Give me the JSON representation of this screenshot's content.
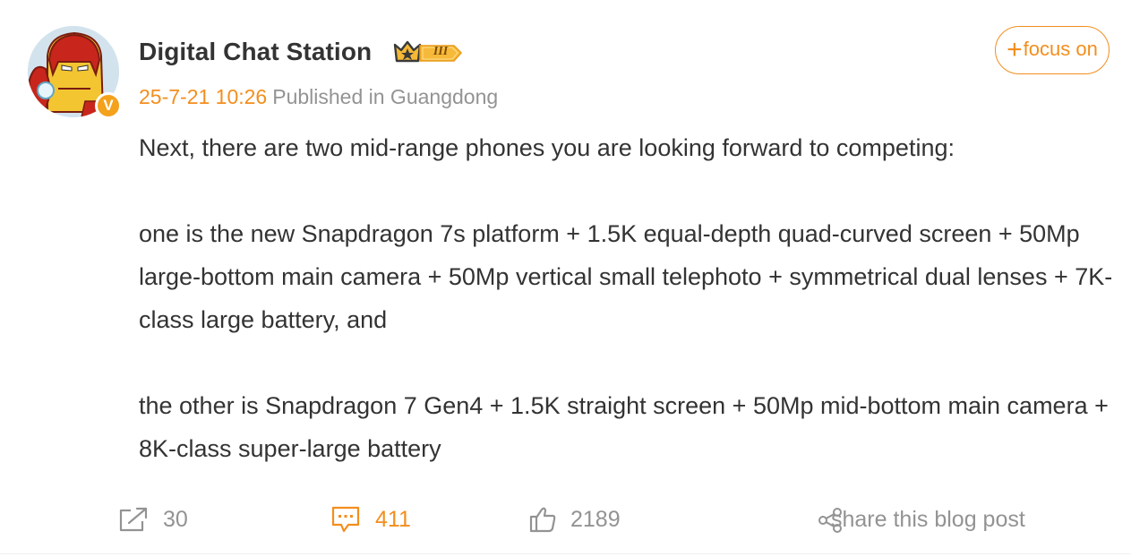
{
  "author": {
    "name": "Digital Chat Station",
    "level_badge": "III",
    "verified_badge": "V",
    "verified_color": "#f4a11c"
  },
  "meta": {
    "time": "25-7-21 10:26",
    "location": "Published in Guangdong"
  },
  "follow": {
    "plus": "+",
    "label": "focus on"
  },
  "post": {
    "paragraphs": [
      "Next, there are two mid-range phones you are looking forward to competing:",
      "one is the new Snapdragon 7s platform + 1.5K equal-depth quad-curved screen + 50Mp large-bottom main camera + 50Mp vertical small telephoto + symmetrical dual lenses + 7K-class large battery, and",
      "the other is Snapdragon 7 Gen4 + 1.5K straight screen + 50Mp mid-bottom main camera + 8K-class super-large battery"
    ]
  },
  "actions": {
    "repost": {
      "icon": "repost-icon",
      "count": "30"
    },
    "comments": {
      "icon": "comment-icon",
      "count": "411"
    },
    "likes": {
      "icon": "thumbs-up-icon",
      "count": "2189"
    },
    "share": {
      "icon": "share-icon",
      "label": "share this blog post"
    }
  },
  "colors": {
    "accent": "#f38e1e",
    "text": "#333333",
    "muted": "#939393"
  }
}
